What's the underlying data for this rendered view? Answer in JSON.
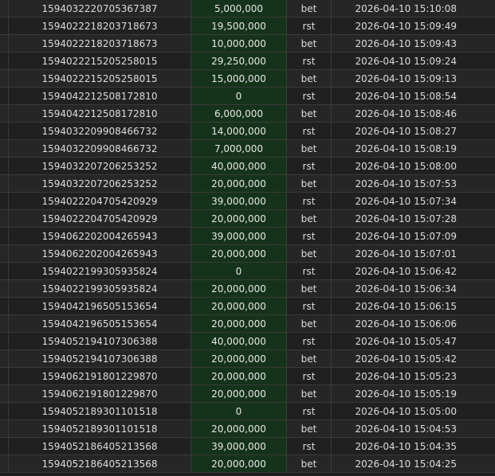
{
  "table": {
    "rows": [
      {
        "id": "1594032220705367387",
        "amount": "5,000,000",
        "type": "bet",
        "time": "2026-04-10 15:10:08"
      },
      {
        "id": "1594022218203718673",
        "amount": "19,500,000",
        "type": "rst",
        "time": "2026-04-10 15:09:49"
      },
      {
        "id": "1594022218203718673",
        "amount": "10,000,000",
        "type": "bet",
        "time": "2026-04-10 15:09:43"
      },
      {
        "id": "1594022215205258015",
        "amount": "29,250,000",
        "type": "rst",
        "time": "2026-04-10 15:09:24"
      },
      {
        "id": "1594022215205258015",
        "amount": "15,000,000",
        "type": "bet",
        "time": "2026-04-10 15:09:13"
      },
      {
        "id": "1594042212508172810",
        "amount": "0",
        "type": "rst",
        "time": "2026-04-10 15:08:54"
      },
      {
        "id": "1594042212508172810",
        "amount": "6,000,000",
        "type": "bet",
        "time": "2026-04-10 15:08:46"
      },
      {
        "id": "1594032209908466732",
        "amount": "14,000,000",
        "type": "rst",
        "time": "2026-04-10 15:08:27"
      },
      {
        "id": "1594032209908466732",
        "amount": "7,000,000",
        "type": "bet",
        "time": "2026-04-10 15:08:19"
      },
      {
        "id": "1594032207206253252",
        "amount": "40,000,000",
        "type": "rst",
        "time": "2026-04-10 15:08:00"
      },
      {
        "id": "1594032207206253252",
        "amount": "20,000,000",
        "type": "bet",
        "time": "2026-04-10 15:07:53"
      },
      {
        "id": "1594022204705420929",
        "amount": "39,000,000",
        "type": "rst",
        "time": "2026-04-10 15:07:34"
      },
      {
        "id": "1594022204705420929",
        "amount": "20,000,000",
        "type": "bet",
        "time": "2026-04-10 15:07:28"
      },
      {
        "id": "1594062202004265943",
        "amount": "39,000,000",
        "type": "rst",
        "time": "2026-04-10 15:07:09"
      },
      {
        "id": "1594062202004265943",
        "amount": "20,000,000",
        "type": "bet",
        "time": "2026-04-10 15:07:01"
      },
      {
        "id": "1594022199305935824",
        "amount": "0",
        "type": "rst",
        "time": "2026-04-10 15:06:42"
      },
      {
        "id": "1594022199305935824",
        "amount": "20,000,000",
        "type": "bet",
        "time": "2026-04-10 15:06:34"
      },
      {
        "id": "1594042196505153654",
        "amount": "20,000,000",
        "type": "rst",
        "time": "2026-04-10 15:06:15"
      },
      {
        "id": "1594042196505153654",
        "amount": "20,000,000",
        "type": "bet",
        "time": "2026-04-10 15:06:06"
      },
      {
        "id": "1594052194107306388",
        "amount": "40,000,000",
        "type": "rst",
        "time": "2026-04-10 15:05:47"
      },
      {
        "id": "1594052194107306388",
        "amount": "20,000,000",
        "type": "bet",
        "time": "2026-04-10 15:05:42"
      },
      {
        "id": "1594062191801229870",
        "amount": "20,000,000",
        "type": "rst",
        "time": "2026-04-10 15:05:23"
      },
      {
        "id": "1594062191801229870",
        "amount": "20,000,000",
        "type": "bet",
        "time": "2026-04-10 15:05:19"
      },
      {
        "id": "1594052189301101518",
        "amount": "0",
        "type": "rst",
        "time": "2026-04-10 15:05:00"
      },
      {
        "id": "1594052189301101518",
        "amount": "20,000,000",
        "type": "bet",
        "time": "2026-04-10 15:04:53"
      },
      {
        "id": "1594052186405213568",
        "amount": "39,000,000",
        "type": "rst",
        "time": "2026-04-10 15:04:35"
      },
      {
        "id": "1594052186405213568",
        "amount": "20,000,000",
        "type": "bet",
        "time": "2026-04-10 15:04:25"
      }
    ]
  }
}
